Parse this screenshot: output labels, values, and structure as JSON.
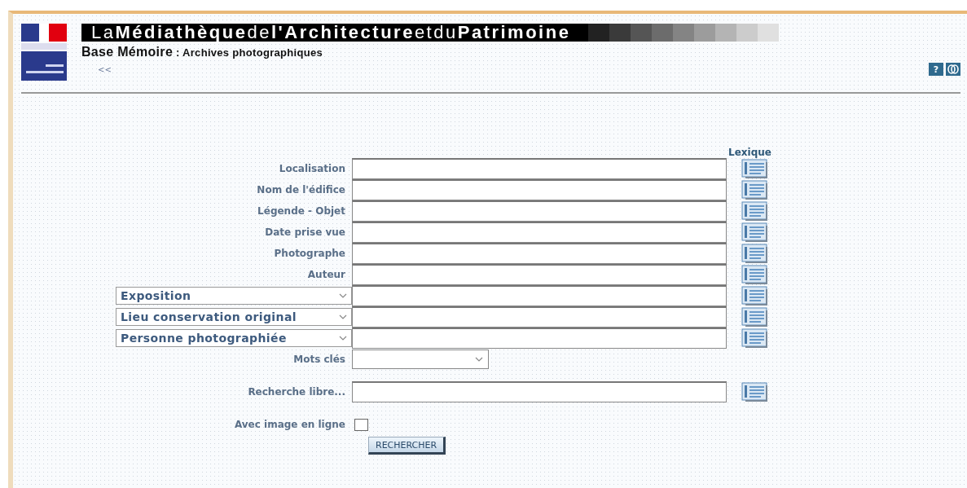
{
  "header": {
    "title": "La**Médiathèque**de**l'Architecture**etdu**Patrimoine**",
    "subtitle": "**Base Mémoire** : Archives photographiques",
    "back_link": "<<",
    "help_button": "?"
  },
  "lexicon_heading": "Lexique",
  "fields": [
    {
      "kind": "label",
      "label": "Localisation"
    },
    {
      "kind": "label",
      "label": "Nom de l'édifice"
    },
    {
      "kind": "label",
      "label": "Légende - Objet"
    },
    {
      "kind": "label",
      "label": "Date prise vue"
    },
    {
      "kind": "label",
      "label": "Photographe"
    },
    {
      "kind": "label",
      "label": "Auteur"
    },
    {
      "kind": "dropdown",
      "label": "Exposition"
    },
    {
      "kind": "dropdown",
      "label": "Lieu conservation original"
    },
    {
      "kind": "dropdown",
      "label": "Personne photographiée"
    }
  ],
  "keywords": {
    "label": "Mots clés"
  },
  "free_search": {
    "label": "Recherche libre..."
  },
  "image_online": {
    "label": "Avec image en ligne",
    "checked": false
  },
  "search_button": "RECHERCHER"
}
